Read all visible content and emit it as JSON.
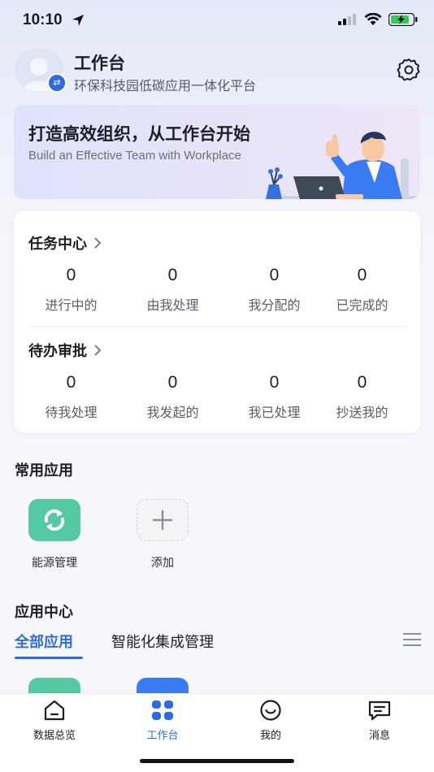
{
  "status_bar": {
    "time": "10:10"
  },
  "header": {
    "title": "工作台",
    "subtitle": "环保科技园低碳应用一体化平台"
  },
  "banner": {
    "title": "打造高效组织，从工作台开始",
    "subtitle": "Build an Effective Team with Workplace"
  },
  "tasks": {
    "title": "任务中心",
    "items": [
      {
        "value": "0",
        "label": "进行中的"
      },
      {
        "value": "0",
        "label": "由我处理"
      },
      {
        "value": "0",
        "label": "我分配的"
      },
      {
        "value": "0",
        "label": "已完成的"
      }
    ]
  },
  "approvals": {
    "title": "待办审批",
    "items": [
      {
        "value": "0",
        "label": "待我处理"
      },
      {
        "value": "0",
        "label": "我发起的"
      },
      {
        "value": "0",
        "label": "我已处理"
      },
      {
        "value": "0",
        "label": "抄送我的"
      }
    ]
  },
  "common_apps": {
    "title": "常用应用",
    "items": [
      {
        "label": "能源管理",
        "icon": "refresh-icon",
        "color": "#57c8a4"
      },
      {
        "label": "添加",
        "icon": "plus-icon",
        "color": "#f3f4f6"
      }
    ]
  },
  "app_center": {
    "title": "应用中心",
    "tabs": [
      {
        "label": "全部应用",
        "active": true
      },
      {
        "label": "智能化集成管理",
        "active": false
      }
    ]
  },
  "bottom_nav": [
    {
      "label": "数据总览",
      "icon": "home-icon",
      "active": false
    },
    {
      "label": "工作台",
      "icon": "grid-icon",
      "active": true
    },
    {
      "label": "我的",
      "icon": "smile-icon",
      "active": false
    },
    {
      "label": "消息",
      "icon": "message-icon",
      "active": false
    }
  ],
  "colors": {
    "accent": "#2f6bdc",
    "app_green": "#57c8a4",
    "background": "#f6f7fb"
  }
}
